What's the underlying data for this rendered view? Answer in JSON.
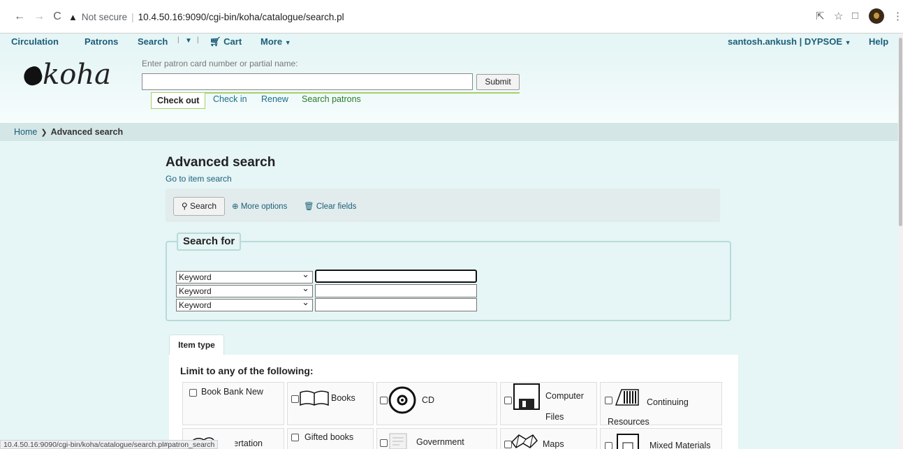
{
  "browser": {
    "security_label": "Not secure",
    "url": "10.4.50.16:9090/cgi-bin/koha/catalogue/search.pl",
    "status_url": "10.4.50.16:9090/cgi-bin/koha/catalogue/search.pl#patron_search"
  },
  "topnav": {
    "circulation": "Circulation",
    "patrons": "Patrons",
    "search": "Search",
    "cart": "Cart",
    "more": "More",
    "user": "santosh.ankush | DYPSOE",
    "help": "Help"
  },
  "header": {
    "logo_text": "koha",
    "patron_hint": "Enter patron card number or partial name:",
    "patron_value": "",
    "submit_label": "Submit",
    "tabs": [
      "Check out",
      "Check in",
      "Renew",
      "Search patrons"
    ]
  },
  "breadcrumb": {
    "home": "Home",
    "current": "Advanced search"
  },
  "main": {
    "title": "Advanced search",
    "item_search_link": "Go to item search",
    "toolbar": {
      "search": "Search",
      "more_options": "More options",
      "clear_fields": "Clear fields"
    },
    "search_for": {
      "legend": "Search for",
      "rows": [
        {
          "index": "Keyword",
          "value": ""
        },
        {
          "index": "Keyword",
          "value": ""
        },
        {
          "index": "Keyword",
          "value": ""
        }
      ]
    },
    "item_type": {
      "tab_label": "Item type",
      "limit_heading": "Limit to any of the following:",
      "types": [
        "Book Bank New",
        "Books",
        "CD",
        "Computer Files",
        "Continuing Resources",
        "Dissertation",
        "Gifted books",
        "Government",
        "Maps",
        "Mixed Materials"
      ]
    }
  }
}
